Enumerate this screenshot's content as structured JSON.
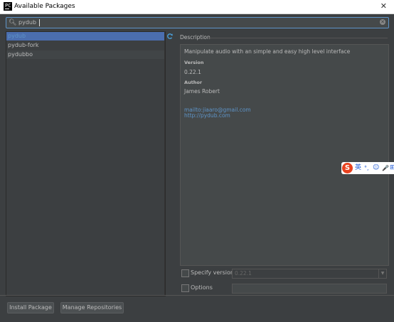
{
  "window": {
    "title": "Available Packages",
    "app_icon_glyph": "PC",
    "close_glyph": "✕"
  },
  "search": {
    "value": "pydub",
    "icon": "search-icon",
    "clear_glyph": "✕"
  },
  "packages": [
    {
      "name": "pydub",
      "selected": true
    },
    {
      "name": "pydub-fork",
      "selected": false
    },
    {
      "name": "pydubbo",
      "selected": false
    }
  ],
  "description": {
    "label": "Description",
    "summary": "Manipulate audio with an simple and easy high level interface",
    "version_label": "Version",
    "version": "0.22.1",
    "author_label": "Author",
    "author": "James Robert",
    "email_link": "mailto:jiaaro@gmail.com",
    "homepage_link": "http://pydub.com"
  },
  "options": {
    "specify_version_label": "Specify version",
    "specify_version_value": "0.22.1",
    "specify_version_checked": false,
    "options_label": "Options",
    "options_checked": false,
    "options_value": ""
  },
  "buttons": {
    "install": "Install Package",
    "manage": "Manage Repositories"
  },
  "ime_toolbar": {
    "logo": "S",
    "lang": "英",
    "punct": "°,",
    "emoji": "☺",
    "mic": "🎤",
    "more": "⊞"
  },
  "colors": {
    "accent": "#4b6eaf",
    "link": "#5e94c8",
    "background": "#3c3f41"
  }
}
